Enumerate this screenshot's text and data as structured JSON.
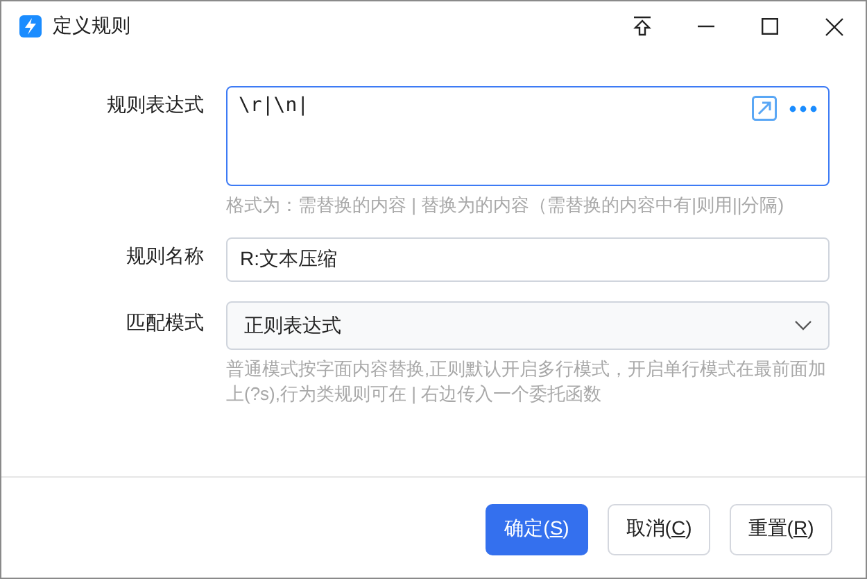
{
  "window": {
    "title": "定义规则"
  },
  "fields": [
    {
      "kind": "textarea",
      "label": "规则表达式",
      "value": "\\r|\\n|",
      "hint": "格式为：需替换的内容 | 替换为的内容（需替换的内容中有|则用||分隔)",
      "focused": true
    },
    {
      "kind": "text",
      "label": "规则名称",
      "value": "R:文本压缩",
      "focused": false
    },
    {
      "kind": "select",
      "label": "匹配模式",
      "value": "正则表达式",
      "hint": "普通模式按字面内容替换,正则默认开启多行模式，开启单行模式在最前面加上(?s),行为类规则可在 | 右边传入一个委托函数",
      "focused": false
    }
  ],
  "buttons": [
    {
      "before": "确定(",
      "key": "S",
      "after": ")",
      "primary": true
    },
    {
      "before": "取消(",
      "key": "C",
      "after": ")",
      "primary": false
    },
    {
      "before": "重置(",
      "key": "R",
      "after": ")",
      "primary": false
    }
  ]
}
